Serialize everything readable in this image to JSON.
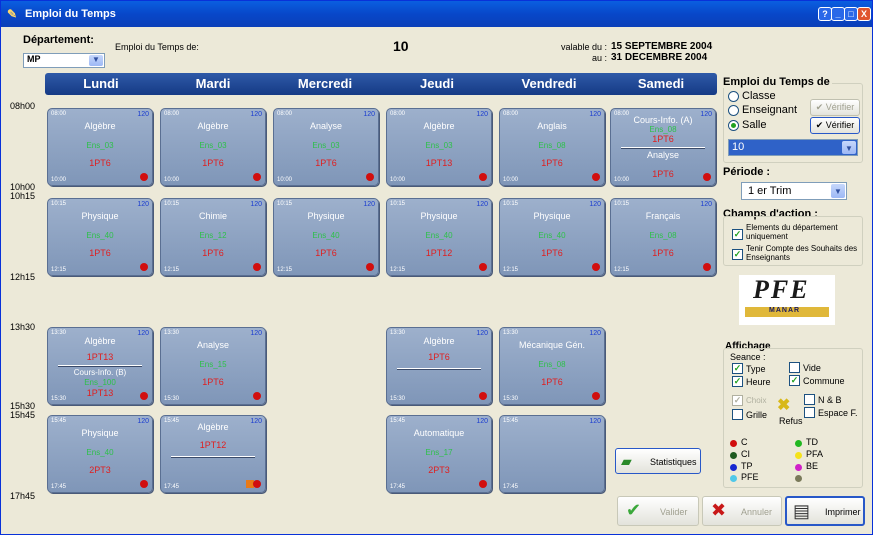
{
  "window": {
    "title": "Emploi du Temps",
    "controls": [
      "?",
      "_",
      "□",
      "X"
    ]
  },
  "header": {
    "dept_label": "Département:",
    "dept_value": "MP",
    "edt_label": "Emploi du Temps de:",
    "number": "10",
    "valable_label": "valable du :",
    "valable_from": "15 SEPTEMBRE 2004",
    "au_label": "au :",
    "valable_to": "31 DECEMBRE 2004"
  },
  "days": [
    "Lundi",
    "Mardi",
    "Mercredi",
    "Jeudi",
    "Vendredi",
    "Samedi"
  ],
  "times": [
    "08h00",
    "10h00",
    "10h15",
    "12h15",
    "13h30",
    "15h30",
    "15h45",
    "17h45"
  ],
  "slots": {
    "s1": {
      "start": "08:00",
      "end": "10:00"
    },
    "s2": {
      "start": "10:15",
      "end": "12:15"
    },
    "s3": {
      "start": "13:30",
      "end": "15:30"
    },
    "s4": {
      "start": "15:45",
      "end": "17:45"
    }
  },
  "sessions": {
    "r1": [
      {
        "subject": "Algèbre",
        "room": "Ens_03",
        "group": "1PT6",
        "cap": "120"
      },
      {
        "subject": "Algèbre",
        "room": "Ens_03",
        "group": "1PT6",
        "cap": "120"
      },
      {
        "subject": "Analyse",
        "room": "Ens_03",
        "group": "1PT6",
        "cap": "120"
      },
      {
        "subject": "Algèbre",
        "room": "Ens_03",
        "group": "1PT13",
        "cap": "120"
      },
      {
        "subject": "Anglais",
        "room": "Ens_08",
        "group": "1PT6",
        "cap": "120"
      },
      {
        "subject": "Cours-Info. (A)",
        "room": "Ens_08",
        "group": "1PT6",
        "subject2": "Analyse",
        "group2": "1PT6",
        "cap": "120"
      }
    ],
    "r2": [
      {
        "subject": "Physique",
        "room": "Ens_40",
        "group": "1PT6",
        "cap": "120"
      },
      {
        "subject": "Chimie",
        "room": "Ens_12",
        "group": "1PT6",
        "cap": "120"
      },
      {
        "subject": "Physique",
        "room": "Ens_40",
        "group": "1PT6",
        "cap": "120"
      },
      {
        "subject": "Physique",
        "room": "Ens_40",
        "group": "1PT12",
        "cap": "120"
      },
      {
        "subject": "Physique",
        "room": "Ens_40",
        "group": "1PT6",
        "cap": "120"
      },
      {
        "subject": "Français",
        "room": "Ens_08",
        "group": "1PT6",
        "cap": "120"
      }
    ],
    "r3": [
      {
        "subject": "Algèbre",
        "group": "1PT13",
        "subject2": "Cours-Info. (B)",
        "room2": "Ens_100",
        "group2": "1PT13",
        "cap": "120"
      },
      {
        "subject": "Analyse",
        "room": "Ens_15",
        "group": "1PT6",
        "cap": "120"
      },
      {
        "subject": "Algèbre",
        "group": "1PT6",
        "cap": "120"
      },
      {
        "subject": "Mécanique Gén.",
        "room": "Ens_08",
        "group": "1PT6",
        "cap": "120"
      }
    ],
    "r4": [
      {
        "subject": "Physique",
        "room": "Ens_40",
        "group": "2PT3",
        "cap": "120"
      },
      {
        "subject": "Algèbre",
        "group": "1PT12",
        "cap": "120"
      },
      {
        "subject": "Automatique",
        "room": "Ens_17",
        "group": "2PT3",
        "cap": "120"
      },
      {
        "subject": "",
        "cap": "120"
      }
    ]
  },
  "side": {
    "edt_title": "Emploi du Temps de",
    "radio_classe": "Classe",
    "radio_enseignant": "Enseignant",
    "radio_salle": "Salle",
    "verifier1": "Vérifier",
    "verifier2": "Vérifier",
    "salle_value": "10",
    "periode_title": "Période :",
    "periode_value": "1 er Trim",
    "champs_title": "Champs d'action :",
    "champ1": "Elements du département uniquement",
    "champ2": "Tenir Compte des Souhaits des Enseignants",
    "logo_text": "PFE",
    "logo_sub": "MANAR",
    "affichage_title": "Affichage",
    "seance_label": "Seance :",
    "type": "Type",
    "vide": "Vide",
    "heure": "Heure",
    "commune": "Commune",
    "choix": "Choix",
    "nb": "N & B",
    "grille": "Grille",
    "refus": "Refus",
    "espace": "Espace F.",
    "legend": [
      {
        "label": "C",
        "color": "#d10e0e"
      },
      {
        "label": "TD",
        "color": "#21b821"
      },
      {
        "label": "CI",
        "color": "#1f5a1f"
      },
      {
        "label": "PFA",
        "color": "#f5e21a"
      },
      {
        "label": "TP",
        "color": "#1828d0"
      },
      {
        "label": "BE",
        "color": "#d020c8"
      },
      {
        "label": "PFE",
        "color": "#50c8e8"
      },
      {
        "label": "",
        "color": "#7a7a5a"
      }
    ]
  },
  "buttons": {
    "statistiques": "Statistiques",
    "valider": "Valider",
    "annuler": "Annuler",
    "imprimer": "Imprimer"
  }
}
